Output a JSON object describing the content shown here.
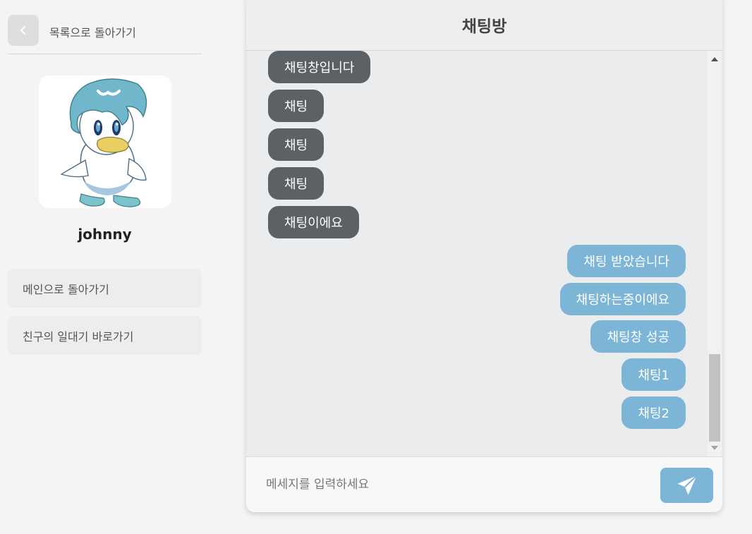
{
  "sidebar": {
    "back_label": "목록으로 돌아가기",
    "username": "johnny",
    "menu": [
      {
        "label": "메인으로 돌아가기"
      },
      {
        "label": "친구의 일대기 바로가기"
      }
    ]
  },
  "chat": {
    "title": "채팅방",
    "messages": [
      {
        "text": "채팅창입니다",
        "side": "left"
      },
      {
        "text": "채팅",
        "side": "left"
      },
      {
        "text": "채팅",
        "side": "left"
      },
      {
        "text": "채팅",
        "side": "left"
      },
      {
        "text": "채팅이에요",
        "side": "left"
      },
      {
        "text": "채팅 받았습니다",
        "side": "right"
      },
      {
        "text": "채팅하는중이에요",
        "side": "right"
      },
      {
        "text": "채팅창 성공",
        "side": "right"
      },
      {
        "text": "채팅1",
        "side": "right"
      },
      {
        "text": "채팅2",
        "side": "right"
      }
    ],
    "input": {
      "placeholder": "메세지를 입력하세요",
      "value": ""
    }
  },
  "icons": {
    "back": "chevron-left-icon",
    "send": "paper-plane-icon"
  },
  "colors": {
    "page_bg": "#f4f4f4",
    "received_bubble": "#5c6165",
    "sent_bubble": "#7db5d6",
    "send_button": "#7db5d6",
    "chat_bg": "#ebecee"
  }
}
